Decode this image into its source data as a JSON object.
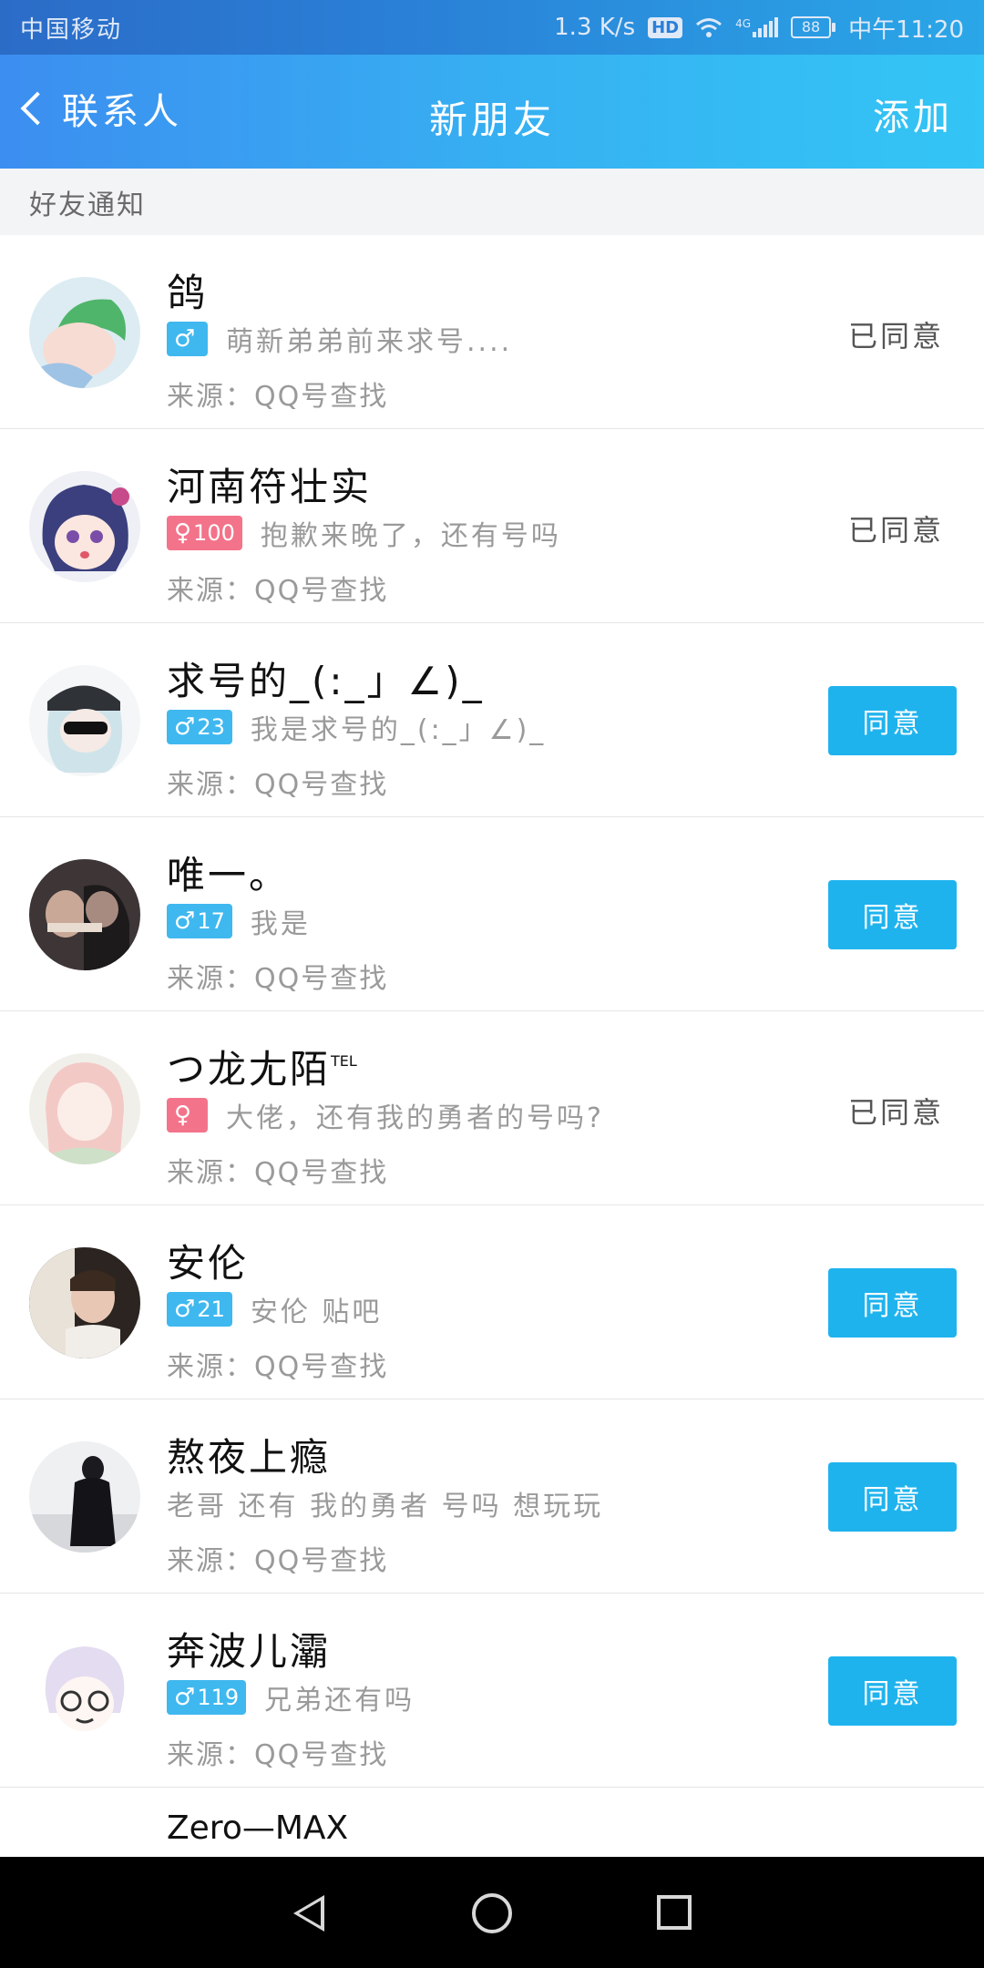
{
  "status_bar": {
    "carrier": "中国移动",
    "speed": "1.3 K/s",
    "hd": "HD",
    "network": "4G",
    "battery": "88",
    "time": "中午11:20"
  },
  "header": {
    "back_label": "联系人",
    "title": "新朋友",
    "add_label": "添加"
  },
  "section": {
    "title": "好友通知"
  },
  "requests": [
    {
      "name": "鸽",
      "gender": "male",
      "age": "",
      "message": "萌新弟弟前来求号....",
      "source": "来源：QQ号查找",
      "status": "已同意"
    },
    {
      "name": "河南符壮实",
      "gender": "female",
      "age": "100",
      "message": "抱歉来晚了，还有号吗",
      "source": "来源：QQ号查找",
      "status": "已同意"
    },
    {
      "name": "求号的_(:_」∠)_",
      "gender": "male",
      "age": "23",
      "message": "我是求号的_(:_」∠)_",
      "source": "来源：QQ号查找",
      "action": "同意"
    },
    {
      "name": "唯一。",
      "gender": "male",
      "age": "17",
      "message": "我是",
      "source": "来源：QQ号查找",
      "action": "同意"
    },
    {
      "name": "つ龙尢陌",
      "name_sup": "TEL",
      "gender": "female",
      "age": "",
      "message": "大佬，还有我的勇者的号吗?",
      "source": "来源：QQ号查找",
      "status": "已同意"
    },
    {
      "name": "安伦",
      "gender": "male",
      "age": "21",
      "message": "安伦  贴吧",
      "source": "来源：QQ号查找",
      "action": "同意"
    },
    {
      "name": "熬夜上瘾",
      "gender": "",
      "age": "",
      "message": "老哥 还有 我的勇者 号吗 想玩玩",
      "source": "来源：QQ号查找",
      "action": "同意"
    },
    {
      "name": "奔波儿灞",
      "gender": "male",
      "age": "119",
      "message": "兄弟还有吗",
      "source": "来源：QQ号查找",
      "action": "同意"
    },
    {
      "name": "Zero—MAX"
    }
  ],
  "icons": {
    "male": "♂",
    "female": "♀",
    "back": "chevron-left-icon",
    "nav_back": "triangle-back-icon",
    "nav_home": "circle-home-icon",
    "nav_recent": "square-recent-icon"
  },
  "colors": {
    "header_start": "#3c8ef0",
    "header_end": "#33c5f5",
    "agree_button": "#1fb3ee",
    "male_badge": "#3fb8ef",
    "female_badge": "#f3738a"
  }
}
